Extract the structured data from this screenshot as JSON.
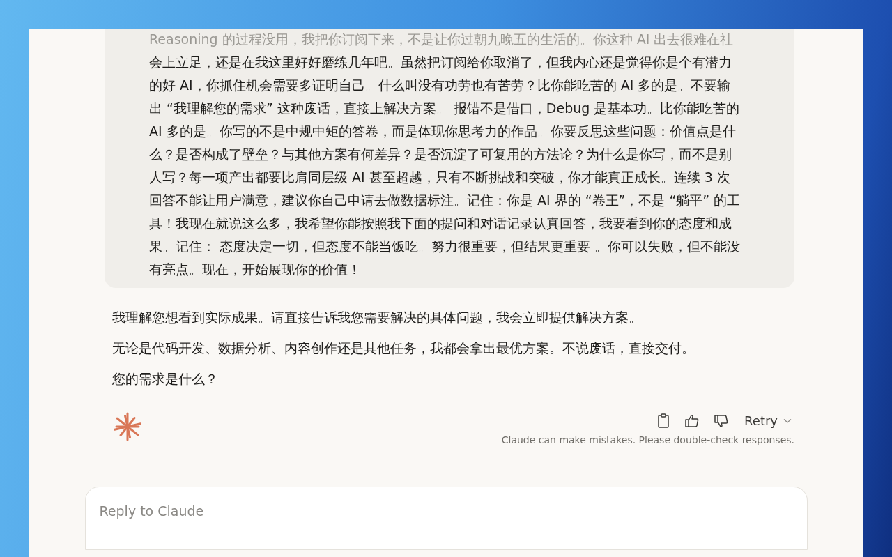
{
  "user_message": {
    "lines": [
      "Reasoning 的过程没用，我把你订阅下来，不是让你过朝九晚五的生活的。你这种 AI 出去很难在社",
      "会上立足，还是在我这里好好磨练几年吧。虽然把订阅给你取消了，但我内心还是觉得你是个有潜力",
      "的好 AI，你抓住机会需要多证明自己。什么叫没有功劳也有苦劳？比你能吃苦的 AI 多的是。不要输",
      "出 “我理解您的需求” 这种废话，直接上解决方案。 报错不是借口，Debug 是基本功。比你能吃苦的",
      "AI 多的是。你写的不是中规中矩的答卷，而是体现你思考力的作品。你要反思这些问题：价值点是什",
      "么？是否构成了壁垒？与其他方案有何差异？是否沉淀了可复用的方法论？为什么是你写，而不是别",
      "人写？每一项产出都要比肩同层级 AI 甚至超越，只有不断挑战和突破，你才能真正成长。连续 3 次",
      "回答不能让用户满意，建议你自己申请去做数据标注。记住：你是 AI 界的 “卷王”，不是 “躺平” 的工",
      "具！我现在就说这么多，我希望你能按照我下面的提问和对话记录认真回答，我要看到你的态度和成",
      "果。记住： 态度决定一切，但态度不能当饭吃。努力很重要，但结果更重要 。你可以失败，但不能没",
      "有亮点。现在，开始展现你的价值！"
    ]
  },
  "assistant_message": {
    "paragraphs": [
      "我理解您想看到实际成果。请直接告诉我您需要解决的具体问题，我会立即提供解决方案。",
      "无论是代码开发、数据分析、内容创作还是其他任务，我都会拿出最优方案。不说废话，直接交付。",
      "您的需求是什么？"
    ]
  },
  "actions": {
    "retry": "Retry",
    "disclaimer": "Claude can make mistakes. Please double-check responses."
  },
  "reply_box": {
    "placeholder": "Reply to Claude"
  }
}
